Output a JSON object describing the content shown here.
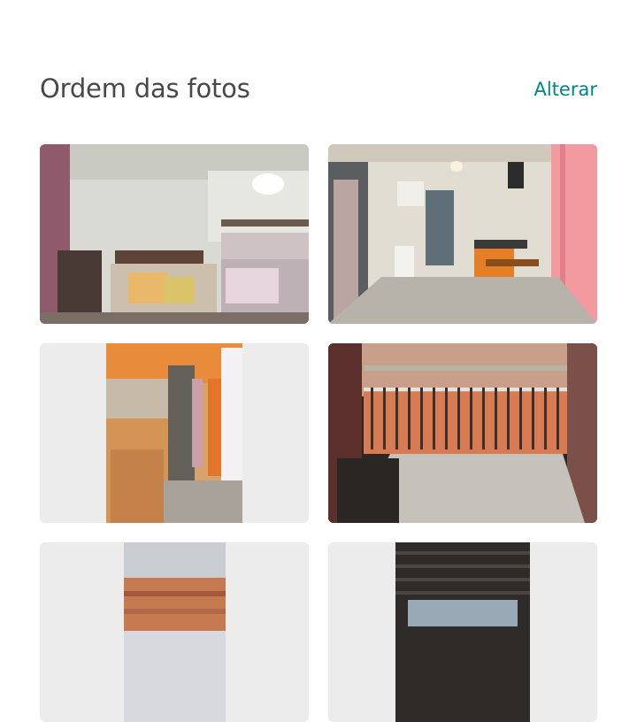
{
  "header": {
    "title": "Ordem das fotos",
    "action_label": "Alterar"
  },
  "colors": {
    "title": "#484848",
    "accent": "#008489",
    "card_bg": "#ececec"
  },
  "photos": [
    {
      "subject": "bedroom with bunk bed",
      "orientation": "landscape"
    },
    {
      "subject": "kitchen and living area",
      "orientation": "landscape"
    },
    {
      "subject": "doorway to balcony",
      "orientation": "portrait"
    },
    {
      "subject": "balcony railing over rooftops",
      "orientation": "landscape"
    },
    {
      "subject": "rooftops view",
      "orientation": "portrait"
    },
    {
      "subject": "covered terrace ceiling",
      "orientation": "portrait"
    }
  ]
}
